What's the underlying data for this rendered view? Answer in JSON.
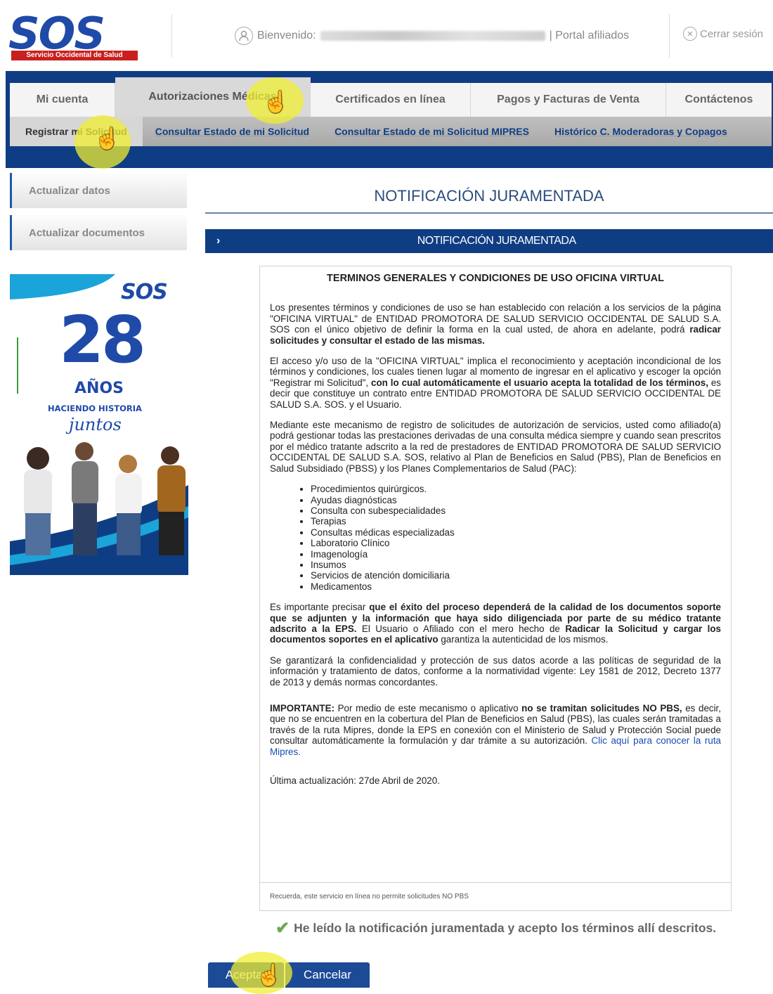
{
  "header": {
    "logo_text": "SOS",
    "logo_tagline": "Servicio Occidental de Salud",
    "welcome_label": "Bienvenido:",
    "portal_label": "| Portal afiliados",
    "logout_label": "Cerrar sesión"
  },
  "nav": {
    "tabs": [
      {
        "label": "Mi cuenta"
      },
      {
        "label": "Autorizaciones Médicas"
      },
      {
        "label": "Certificados en línea"
      },
      {
        "label": "Pagos y Facturas de Venta"
      },
      {
        "label": "Contáctenos"
      }
    ],
    "subtabs": [
      {
        "label": "Registrar mi Solicitud"
      },
      {
        "label": "Consultar Estado de mi Solicitud"
      },
      {
        "label": "Consultar Estado de mi Solicitud MIPRES"
      },
      {
        "label": "Histórico C. Moderadoras y Copagos"
      }
    ]
  },
  "sidebar": {
    "items": [
      {
        "label": "Actualizar datos"
      },
      {
        "label": "Actualizar documentos"
      }
    ],
    "banner": {
      "brand": "SOS",
      "number": "28",
      "years": "AÑOS",
      "tagline": "HACIENDO HISTORIA",
      "script": "juntos"
    }
  },
  "main": {
    "title": "NOTIFICACIÓN JURAMENTADA",
    "section_header": "NOTIFICACIÓN JURAMENTADA",
    "terms": {
      "heading": "TERMINOS GENERALES Y CONDICIONES DE USO OFICINA VIRTUAL",
      "p1_a": "Los presentes términos y condiciones de uso se han establecido con relación a los servicios de la página \"OFICINA VIRTUAL\" de ENTIDAD PROMOTORA DE SALUD SERVICIO OCCIDENTAL DE SALUD S.A. SOS con el único objetivo de definir la forma en la cual usted, de ahora en adelante, podrá ",
      "p1_b": "radicar solicitudes y consultar el estado de las mismas.",
      "p2_a": "El acceso y/o uso de la \"OFICINA VIRTUAL\" implica el reconocimiento y aceptación incondicional de los términos y condiciones, los cuales tienen lugar al momento de ingresar en el aplicativo y escoger la opción \"Registrar mi Solicitud\", ",
      "p2_b": "con lo cual automáticamente el usuario acepta la totalidad de los términos,",
      "p2_c": " es decir que constituye un contrato entre ENTIDAD PROMOTORA DE SALUD SERVICIO OCCIDENTAL DE SALUD S.A. SOS. y el Usuario.",
      "p3": "Mediante este mecanismo de registro de solicitudes de autorización de servicios, usted como afiliado(a) podrá gestionar todas las prestaciones derivadas de una consulta médica siempre y cuando sean prescritos por el médico tratante adscrito a la red de prestadores de ENTIDAD PROMOTORA DE SALUD SERVICIO OCCIDENTAL DE SALUD S.A. SOS, relativo al Plan de Beneficios en Salud (PBS), Plan de Beneficios en Salud Subsidiado (PBSS) y los Planes Complementarios de Salud (PAC):",
      "list": [
        "Procedimientos quirúrgicos.",
        "Ayudas diagnósticas",
        "Consulta con subespecialidades",
        "Terapias",
        "Consultas médicas especializadas",
        "Laboratorio Clínico",
        "Imagenología",
        "Insumos",
        "Servicios de atención domiciliaria",
        "Medicamentos"
      ],
      "p4_a": "Es importante precisar ",
      "p4_b": "que el éxito del proceso dependerá de la calidad de los documentos soporte que se adjunten y la información que haya sido diligenciada por parte de su médico tratante adscrito a la EPS.",
      "p4_c": " El Usuario o Afiliado con el mero hecho de ",
      "p4_d": "Radicar la Solicitud y cargar los documentos soportes en el aplicativo",
      "p4_e": " garantiza la autenticidad de los mismos.",
      "p5": "Se garantizará la confidencialidad y protección de sus datos acorde a las políticas de seguridad de la información y tratamiento de datos, conforme a la normatividad vigente: Ley 1581 de 2012, Decreto 1377 de 2013 y demás normas concordantes.",
      "p6_a": "IMPORTANTE:",
      "p6_b": " Por medio de este mecanismo o aplicativo ",
      "p6_c": "no se tramitan solicitudes NO PBS,",
      "p6_d": " es decir, que no se encuentren en la cobertura del Plan de Beneficios en Salud (PBS), las cuales serán tramitadas a través de la ruta Mipres, donde la EPS en conexión con el Ministerio de Salud y Protección Social puede consultar automáticamente la formulación y dar trámite a su autorización. ",
      "p6_link": "Clic aquí para conocer la ruta Mipres.",
      "updated": "Última actualización: 27de Abril de 2020."
    },
    "note": "Recuerda, este servicio en línea no permite solicitudes NO PBS",
    "accept_text": "He leído la notificación juramentada y acepto los términos allí descritos.",
    "buttons": {
      "accept": "Aceptar",
      "cancel": "Cancelar"
    }
  },
  "colors": {
    "brand_blue": "#0f3d83",
    "brand_red": "#c8201e",
    "highlight": "#f0ee32",
    "check_green": "#6aa84f"
  }
}
